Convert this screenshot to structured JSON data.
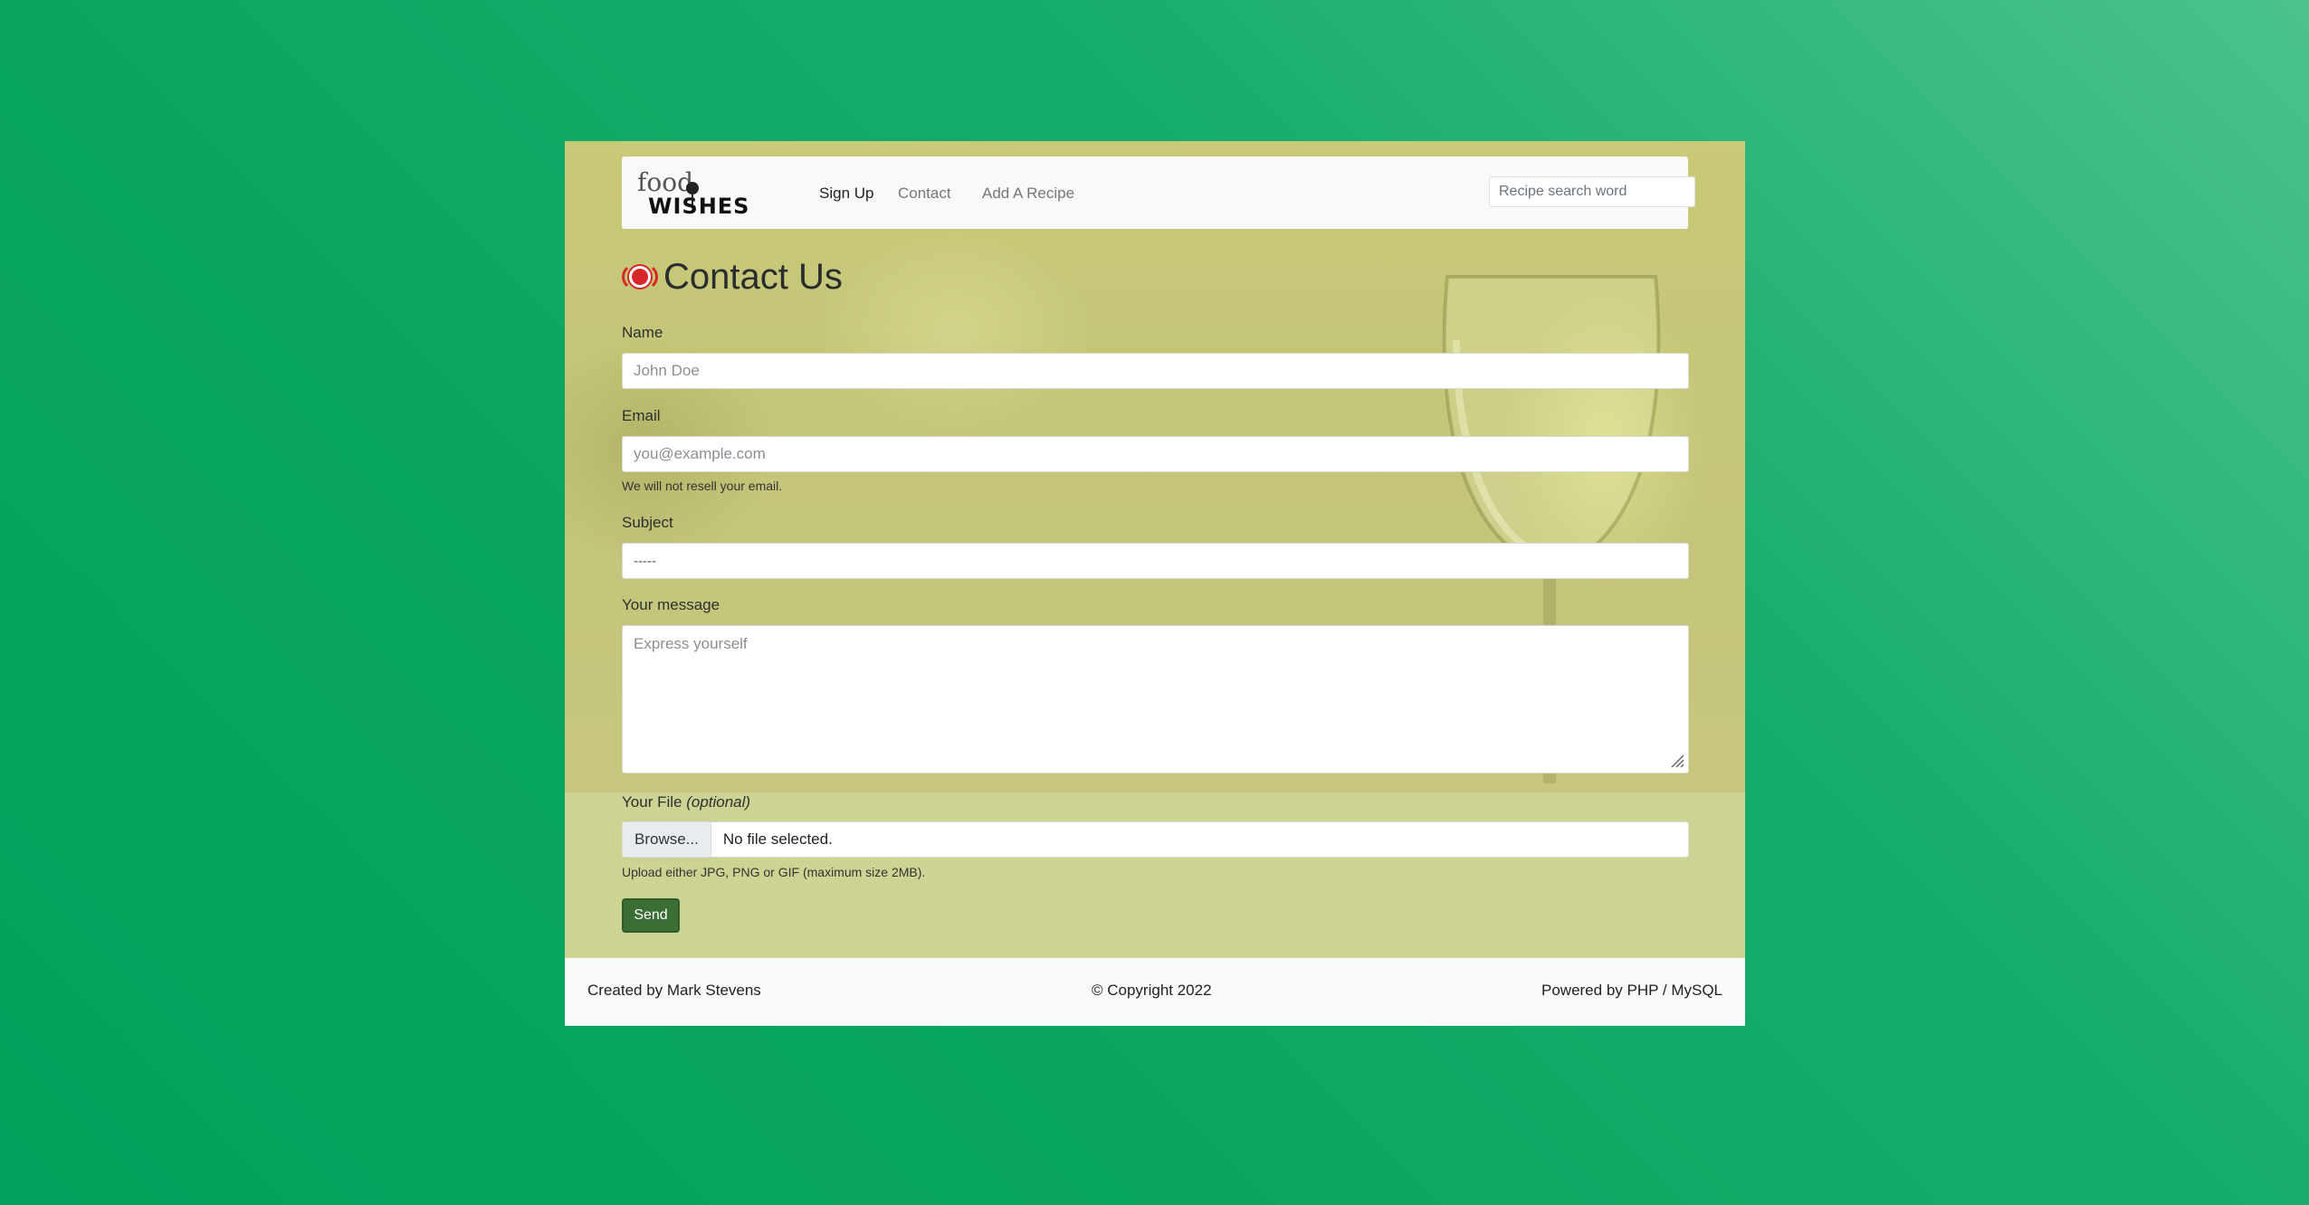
{
  "navbar": {
    "logo_top": "food",
    "logo_bottom": "WISHES",
    "links": [
      {
        "label": "Sign Up"
      },
      {
        "label": "Contact"
      },
      {
        "label": "Add A Recipe"
      }
    ],
    "search_placeholder": "Recipe search word"
  },
  "page": {
    "title": "Contact Us"
  },
  "form": {
    "name_label": "Name",
    "name_placeholder": "John Doe",
    "email_label": "Email",
    "email_placeholder": "you@example.com",
    "email_help": "We will not resell your email.",
    "subject_label": "Subject",
    "subject_value": "-----",
    "message_label": "Your message",
    "message_placeholder": "Express yourself",
    "file_label": "Your File",
    "file_label_optional": "(optional)",
    "file_browse": "Browse...",
    "file_status": "No file selected.",
    "file_help": "Upload either JPG, PNG or GIF (maximum size 2MB).",
    "send_label": "Send"
  },
  "footer": {
    "created_by": "Created by Mark Stevens",
    "copyright": "© Copyright 2022",
    "powered_by": "Powered by PHP / MySQL"
  },
  "colors": {
    "background": "#0aa65f",
    "page_bg": "#cdd493",
    "send_button": "#3b6e35",
    "icon_red": "#d62828"
  },
  "icons": {
    "heading_icon": "red-plate-icon",
    "resize_icon": "resize-grip-icon"
  }
}
